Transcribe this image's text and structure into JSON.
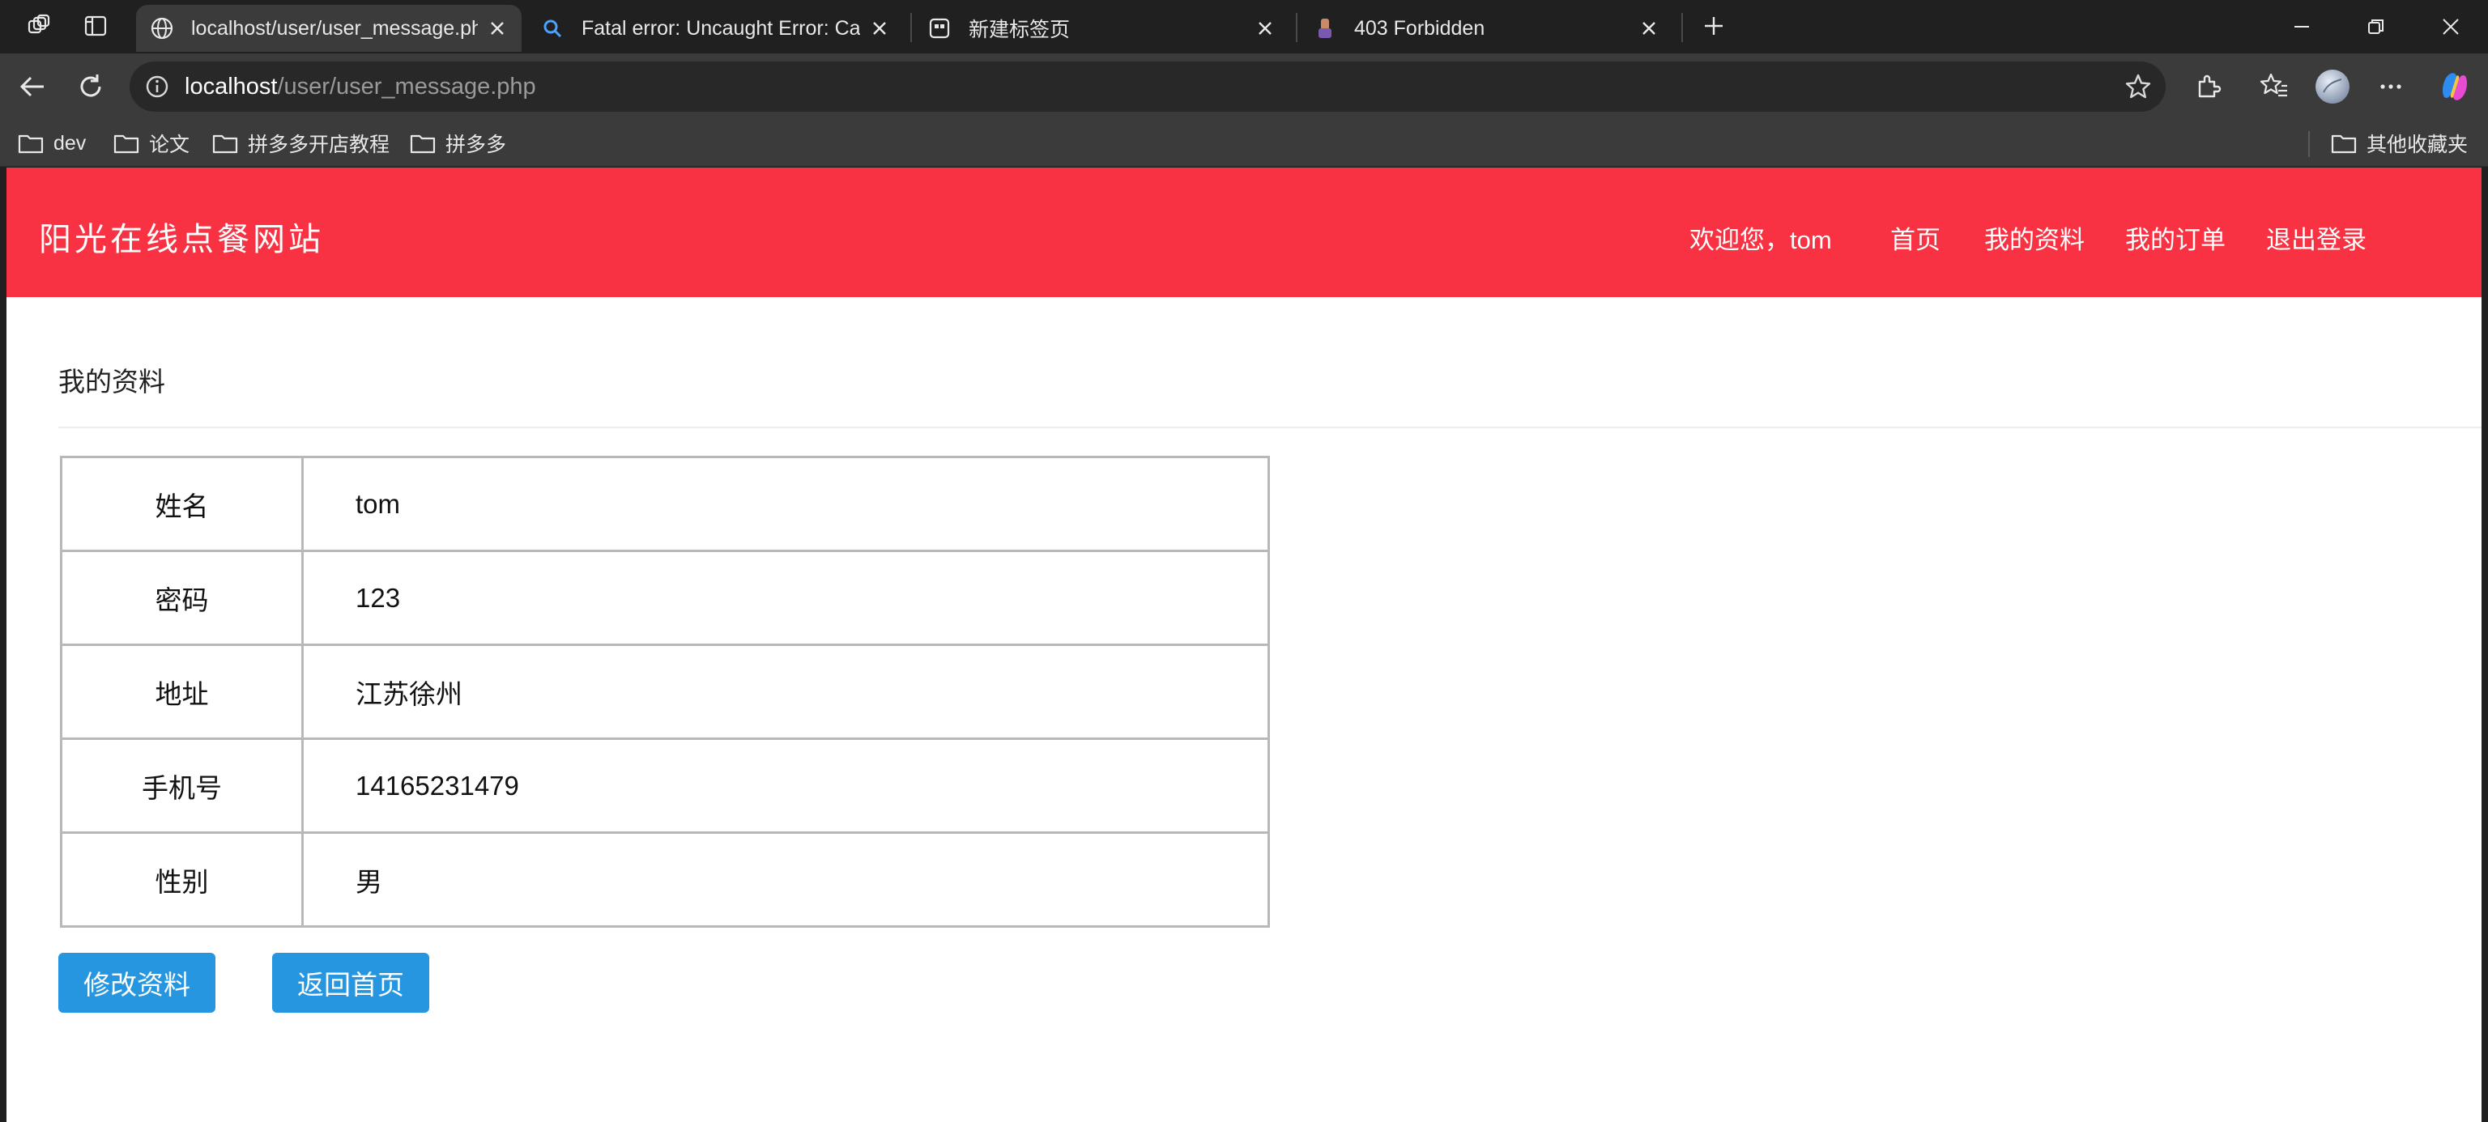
{
  "tabs": [
    {
      "title": "localhost/user/user_message.php",
      "active": true,
      "favicon": "globe-icon"
    },
    {
      "title": "Fatal error: Uncaught Error: Call to",
      "active": false,
      "favicon": "search-icon"
    },
    {
      "title": "新建标签页",
      "active": false,
      "favicon": "new-tab-icon"
    },
    {
      "title": "403 Forbidden",
      "active": false,
      "favicon": "page-favicon"
    }
  ],
  "address": {
    "host": "localhost",
    "path": "/user/user_message.php"
  },
  "bookmarks": [
    {
      "label": "dev"
    },
    {
      "label": "论文"
    },
    {
      "label": "拼多多开店教程"
    },
    {
      "label": "拼多多"
    }
  ],
  "bookmarks_other": "其他收藏夹",
  "site": {
    "brand": "阳光在线点餐网站",
    "welcome": "欢迎您，tom",
    "nav": [
      "首页",
      "我的资料",
      "我的订单",
      "退出登录"
    ]
  },
  "profile": {
    "title": "我的资料",
    "rows": [
      {
        "label": "姓名",
        "value": "tom"
      },
      {
        "label": "密码",
        "value": "123"
      },
      {
        "label": "地址",
        "value": "江苏徐州"
      },
      {
        "label": "手机号",
        "value": "14165231479"
      },
      {
        "label": "性别",
        "value": "男"
      }
    ],
    "edit_label": "修改资料",
    "home_label": "返回首页"
  },
  "colors": {
    "header": "#f83242",
    "button": "#2796e0"
  }
}
